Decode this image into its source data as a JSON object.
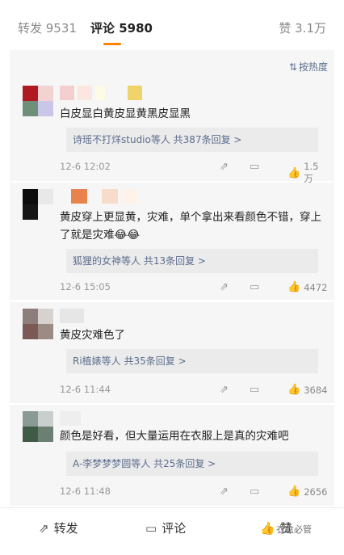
{
  "tabs": {
    "repost": "转发 9531",
    "comment": "评论 5980",
    "like": "赞 3.1万"
  },
  "sort": {
    "label": "按热度",
    "icon": "sort-icon"
  },
  "comments": [
    {
      "text": "白皮显白黄皮显黄黑皮显黑",
      "reply": "诗瑶不打烊studio等人  共387条回复 >",
      "time": "12-6 12:02",
      "likes": "1.5万"
    },
    {
      "text": "黄皮穿上更显黄，灾难，单个拿出来看颜色不错，穿上了就是灾难😂😂",
      "reply": "狐狸的女神等人  共13条回复 >",
      "time": "12-6 15:05",
      "likes": "4472"
    },
    {
      "text": "黄皮灾难色了",
      "reply": "Ri植婊等人  共35条回复 >",
      "time": "12-6 11:44",
      "likes": "3684"
    },
    {
      "text": "颜色是好看，但大量运用在衣服上是真的灾难吧",
      "reply": "A-李梦梦梦圆等人  共25条回复 >",
      "time": "12-6 11:48",
      "likes": "2656"
    }
  ],
  "bottom": {
    "repost": "转发",
    "comment": "评论",
    "like": "赞"
  },
  "watermark": "衣盒必管",
  "colors": {
    "accent": "#ff8200",
    "link": "#5d6e8e",
    "panel": "#f6f6f6"
  }
}
